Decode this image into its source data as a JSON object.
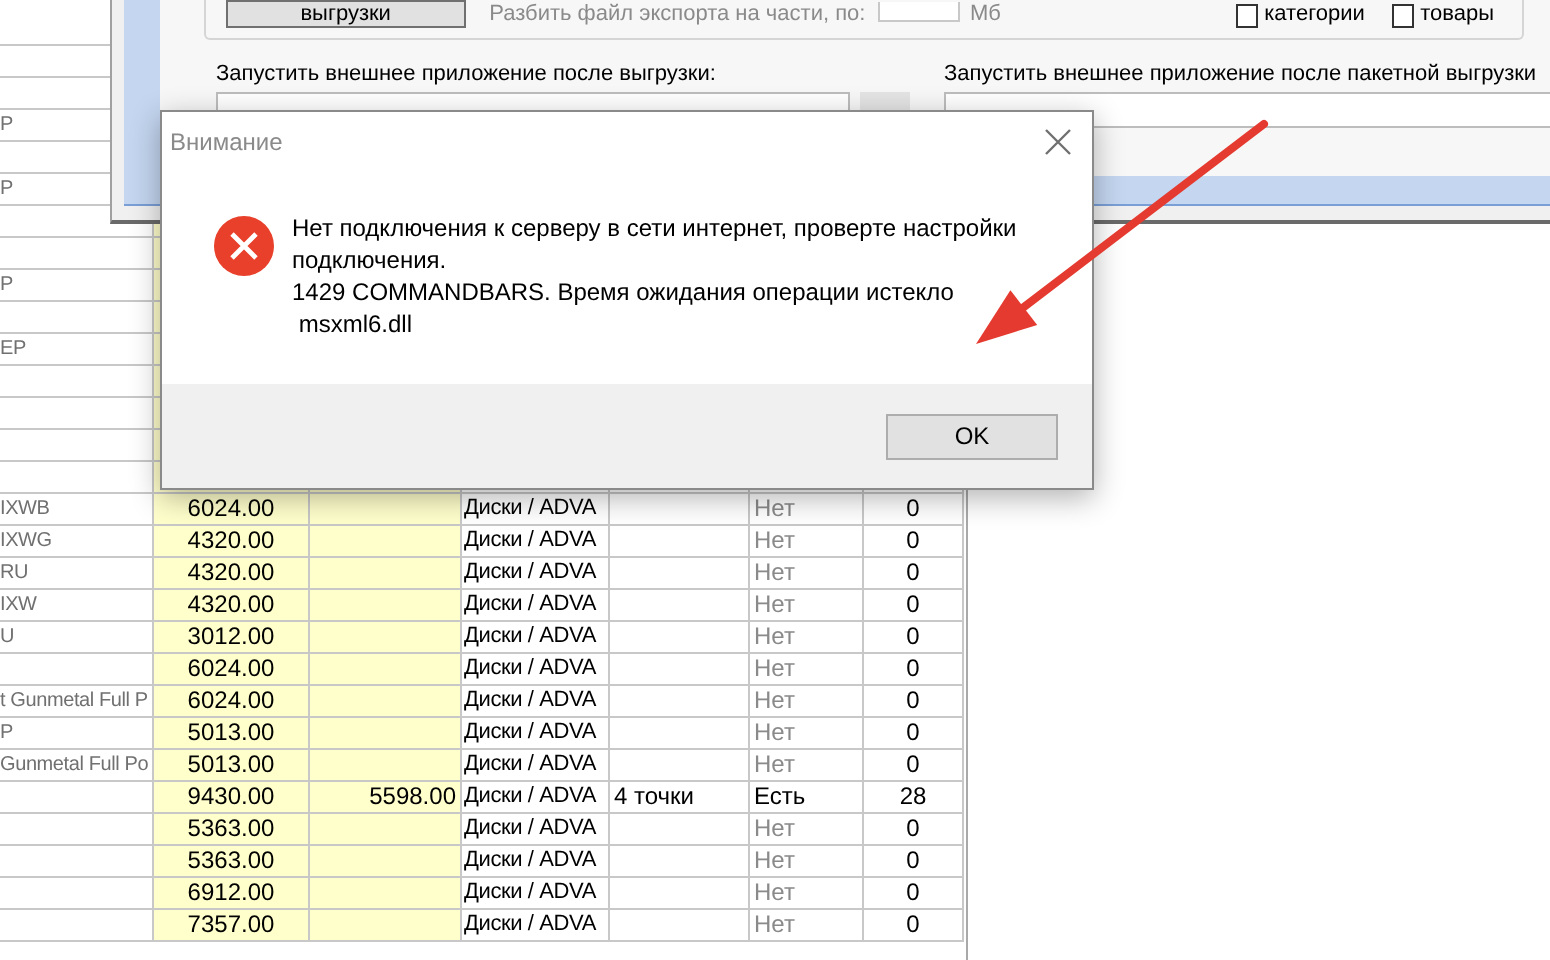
{
  "settings_panel": {
    "export_button": "выгрузки",
    "split_label": "Разбить файл экспорта на части, по:",
    "split_unit": "Мб",
    "checkboxes": [
      {
        "label": "категории",
        "checked": false
      },
      {
        "label": "товары",
        "checked": false
      }
    ],
    "run_after_export_label": "Запустить внешнее приложение после выгрузки:",
    "run_after_batch_label": "Запустить внешнее приложение после пакетной выгрузки"
  },
  "table": {
    "rows": [
      {},
      {},
      {},
      {
        "name": "P"
      },
      {},
      {
        "name": "P"
      },
      {},
      {},
      {
        "name": "P"
      },
      {},
      {
        "name": "EP"
      },
      {},
      {},
      {},
      {},
      {
        "name": "IXWB",
        "price": "6024.00",
        "category": "Диски / ADVA",
        "available": false,
        "status": "Нет",
        "count": "0"
      },
      {
        "name": "IXWG",
        "price": "4320.00",
        "category": "Диски / ADVA",
        "available": false,
        "status": "Нет",
        "count": "0"
      },
      {
        "name": "RU",
        "price": "4320.00",
        "category": "Диски / ADVA",
        "available": false,
        "status": "Нет",
        "count": "0"
      },
      {
        "name": "IXW",
        "price": "4320.00",
        "category": "Диски / ADVA",
        "available": false,
        "status": "Нет",
        "count": "0"
      },
      {
        "name": "U",
        "price": "3012.00",
        "category": "Диски / ADVA",
        "available": false,
        "status": "Нет",
        "count": "0"
      },
      {
        "price": "6024.00",
        "category": "Диски / ADVA",
        "available": false,
        "status": "Нет",
        "count": "0"
      },
      {
        "name": "t Gunmetal Full P",
        "price": "6024.00",
        "category": "Диски / ADVA",
        "available": false,
        "status": "Нет",
        "count": "0"
      },
      {
        "name": "P",
        "price": "5013.00",
        "category": "Диски / ADVA",
        "available": false,
        "status": "Нет",
        "count": "0"
      },
      {
        "name": "Gunmetal Full Po",
        "price": "5013.00",
        "category": "Диски / ADVA",
        "available": false,
        "status": "Нет",
        "count": "0"
      },
      {
        "price": "9430.00",
        "price_2": "5598.00",
        "category": "Диски / ADVA",
        "mount": "4 точки",
        "available": true,
        "status": "Есть",
        "count": "28"
      },
      {
        "price": "5363.00",
        "category": "Диски / ADVA",
        "available": false,
        "status": "Нет",
        "count": "0"
      },
      {
        "price": "5363.00",
        "category": "Диски / ADVA",
        "available": false,
        "status": "Нет",
        "count": "0"
      },
      {
        "price": "6912.00",
        "category": "Диски / ADVA",
        "available": false,
        "status": "Нет",
        "count": "0"
      },
      {
        "price": "7357.00",
        "category": "Диски / ADVA",
        "available": false,
        "status": "Нет",
        "count": "0"
      }
    ]
  },
  "dialog": {
    "title": "Внимание",
    "message_lines": [
      "Нет подключения к серверу в сети интернет, проверте настройки",
      "подключения.",
      "1429 COMMANDBARS. Время ожидания операции истекло",
      " msxml6.dll"
    ],
    "buttons": [
      "OK"
    ]
  }
}
